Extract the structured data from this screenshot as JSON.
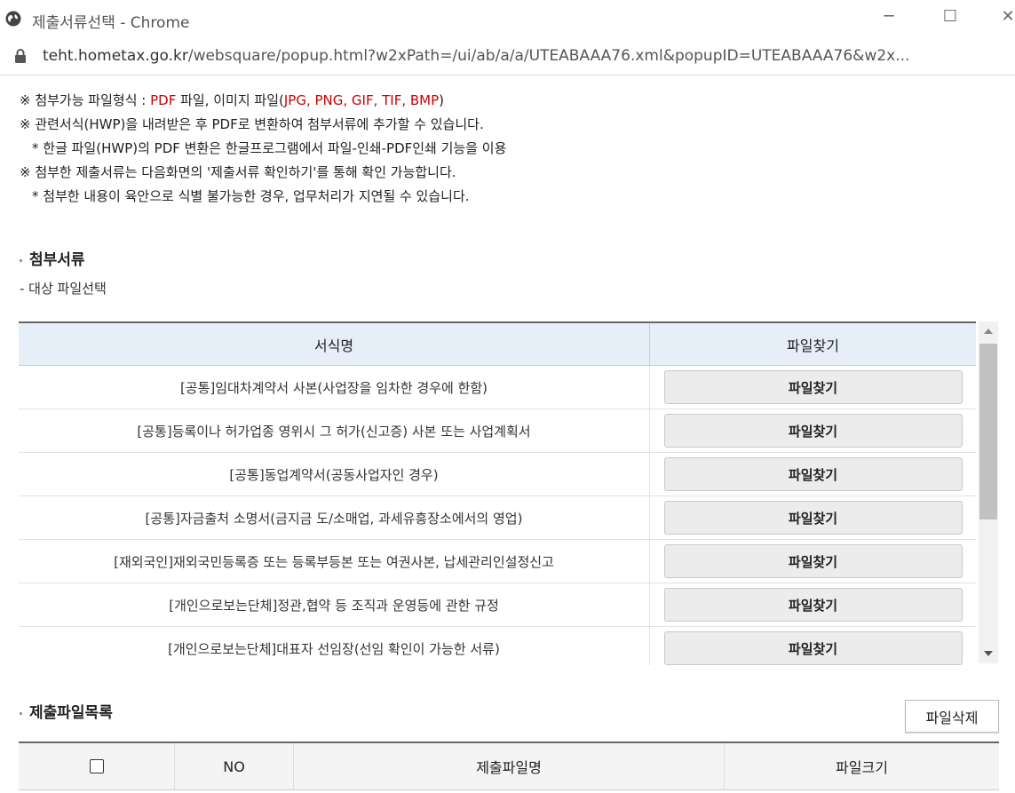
{
  "window": {
    "title": "제출서류선택 - Chrome",
    "url_host": "teht.hometax.go.kr",
    "url_path": "/websquare/popup.html?w2xPath=/ui/ab/a/a/UTEABAAA76.xml&popupID=UTEABAAA76&w2x..."
  },
  "notes": {
    "n1_prefix": "※ 첨부가능 파일형식 : ",
    "n1_pdf": "PDF",
    "n1_mid": " 파일, 이미지 파일(",
    "n1_formats": "JPG, PNG, GIF, TIF, BMP",
    "n1_suffix": ")",
    "n2": "※ 관련서식(HWP)을 내려받은 후 PDF로 변환하여 첨부서류에 추가할 수 있습니다.",
    "n3": "* 한글 파일(HWP)의 PDF 변환은 한글프로그램에서 파일-인쇄-PDF인쇄 기능을 이용",
    "n4": "※ 첨부한 제출서류는 다음화면의 '제출서류 확인하기'를 통해 확인 가능합니다.",
    "n5": "* 첨부한 내용이 육안으로 식별 불가능한 경우, 업무처리가 지연될 수 있습니다."
  },
  "attach": {
    "title": "첨부서류",
    "subtitle": "- 대상 파일선택",
    "col_name": "서식명",
    "col_find": "파일찾기",
    "rows": [
      {
        "name": "[공통]임대차계약서 사본(사업장을 임차한 경우에 한함)",
        "button": "파일찾기"
      },
      {
        "name": "[공통]등록이나 허가업종 영위시 그 허가(신고증) 사본 또는 사업계획서",
        "button": "파일찾기"
      },
      {
        "name": "[공통]동업계약서(공동사업자인 경우)",
        "button": "파일찾기"
      },
      {
        "name": "[공통]자금출처 소명서(금지금 도/소매업, 과세유흥장소에서의 영업)",
        "button": "파일찾기"
      },
      {
        "name": "[재외국인]재외국민등록증 또는 등록부등본 또는 여권사본, 납세관리인설정신고",
        "button": "파일찾기"
      },
      {
        "name": "[개인으로보는단체]정관,협약 등 조직과 운영등에 관한 규정",
        "button": "파일찾기"
      },
      {
        "name": "[개인으로보는단체]대표자 선임장(선임 확인이 가능한 서류)",
        "button": "파일찾기"
      }
    ]
  },
  "submit": {
    "title": "제출파일목록",
    "delete_label": "파일삭제",
    "col_no": "NO",
    "col_file": "제출파일명",
    "col_size": "파일크기"
  }
}
